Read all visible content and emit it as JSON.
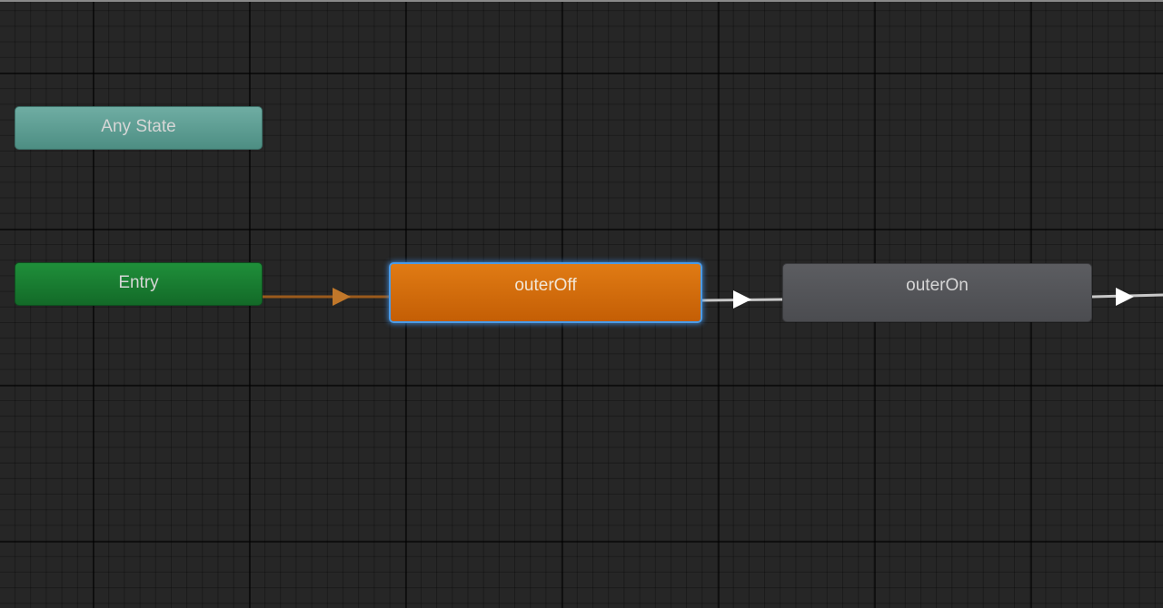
{
  "graph": {
    "states": {
      "any_state": {
        "label": "Any State",
        "color": "#5e9f95"
      },
      "entry": {
        "label": "Entry",
        "color": "#177d31"
      },
      "outer_off": {
        "label": "outerOff",
        "color": "#d66d0c",
        "selected": true,
        "selection_color": "#4a9be8"
      },
      "outer_on": {
        "label": "outerOn",
        "color": "#54555a"
      }
    },
    "transitions": [
      {
        "from": "Entry",
        "to": "outerOff",
        "color": "#9a5a1c",
        "arrow_color": "#c0772a"
      },
      {
        "from": "outerOff",
        "to": "outerOn",
        "color": "#c8c8c8",
        "arrow_color": "#ffffff"
      },
      {
        "from": "outerOn",
        "to": "",
        "color": "#c8c8c8",
        "arrow_color": "#ffffff"
      }
    ]
  }
}
